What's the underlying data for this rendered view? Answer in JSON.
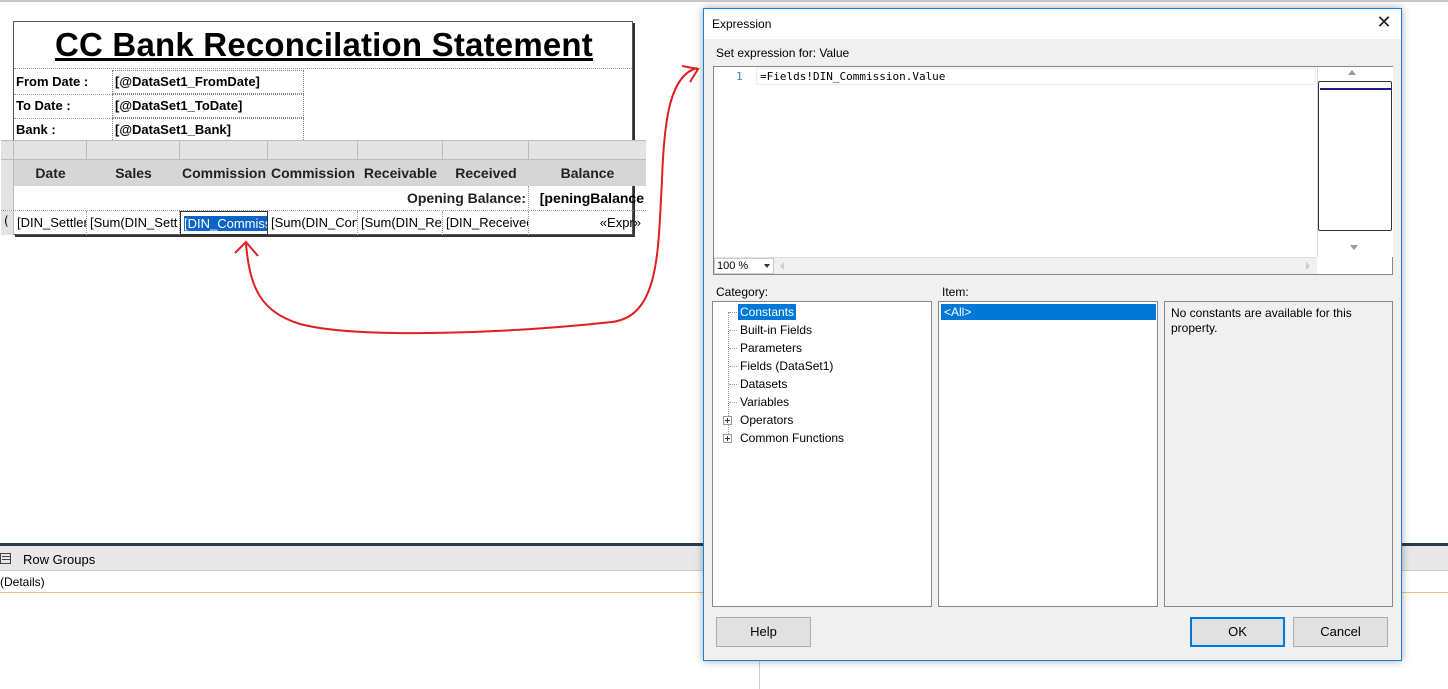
{
  "report": {
    "title": "CC Bank Reconcilation Statement",
    "params": [
      {
        "label": "From Date :",
        "value": "[@DataSet1_FromDate]"
      },
      {
        "label": "To Date :",
        "value": "[@DataSet1_ToDate]"
      },
      {
        "label": "Bank :",
        "value": "[@DataSet1_Bank]"
      }
    ],
    "columns": [
      "Date",
      "Sales",
      "Commission",
      "Commission",
      "Receivable",
      "Received",
      "Balance"
    ],
    "opening_label": "Opening Balance:",
    "opening_value": "peningBalance]",
    "row_gutter": "(",
    "data_cells": [
      "[DIN_Settler",
      "[Sum(DIN_Sett",
      "[DIN_Commiss",
      "[Sum(DIN_Con",
      "[Sum(DIN_Re",
      "[DIN_Receivec",
      "«Expr»"
    ]
  },
  "row_groups": {
    "title": "Row Groups",
    "details": "(Details)"
  },
  "dialog": {
    "title": "Expression",
    "close": "✕",
    "set_expression_label": "Set expression for: Value",
    "line_number": "1",
    "expression": "=Fields!DIN_Commission.Value",
    "zoom": "100 %",
    "category_label": "Category:",
    "item_label": "Item:",
    "categories": [
      "Constants",
      "Built-in Fields",
      "Parameters",
      "Fields (DataSet1)",
      "Datasets",
      "Variables",
      "Operators",
      "Common Functions"
    ],
    "selected_item": "<All>",
    "description": "No constants are available for this property.",
    "help_button": "Help",
    "ok_button": "OK",
    "cancel_button": "Cancel"
  },
  "colors": {
    "accent": "#0078d7",
    "selection_cell": "#0a64c8",
    "annotation": "#e02020",
    "header_bg": "#d6d6d6"
  }
}
